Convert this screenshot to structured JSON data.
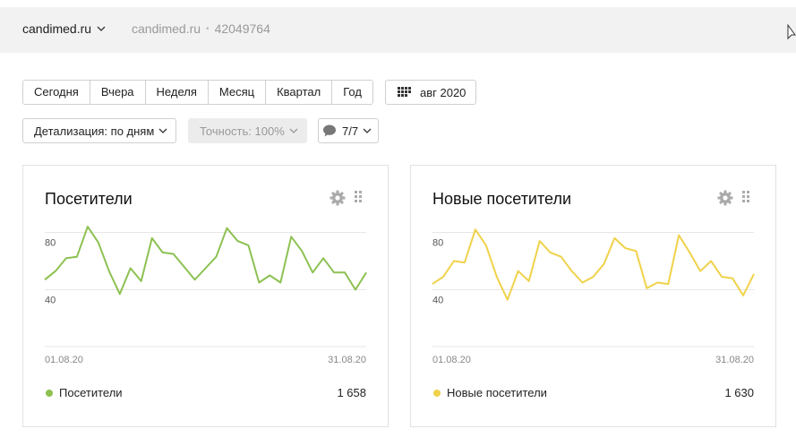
{
  "header": {
    "site_name": "candimed.ru",
    "site_domain": "candimed.ru",
    "site_separator": "•",
    "counter_id": "42049764"
  },
  "period": {
    "buttons": [
      "Сегодня",
      "Вчера",
      "Неделя",
      "Месяц",
      "Квартал",
      "Год"
    ],
    "date_range": "авг 2020"
  },
  "filters": {
    "detail": "Детализация: по дням",
    "accuracy": "Точность: 100%",
    "segments": "7/7"
  },
  "colors": {
    "visitors": "#8cc152",
    "new_visitors": "#f0d24a"
  },
  "widgets": [
    {
      "title": "Посетители",
      "legend": "Посетители",
      "total": "1 658",
      "x_start": "01.08.20",
      "x_end": "31.08.20",
      "y_ticks": [
        "80",
        "40"
      ]
    },
    {
      "title": "Новые посетители",
      "legend": "Новые посетители",
      "total": "1 630",
      "x_start": "01.08.20",
      "x_end": "31.08.20",
      "y_ticks": [
        "80",
        "40"
      ]
    }
  ],
  "chart_data": [
    {
      "type": "line",
      "series": [
        {
          "name": "Посетители",
          "values": [
            47,
            53,
            62,
            63,
            84,
            73,
            53,
            37,
            55,
            46,
            76,
            66,
            65,
            56,
            47,
            55,
            63,
            83,
            74,
            71,
            45,
            50,
            45,
            77,
            67,
            52,
            62,
            52,
            52,
            40,
            52
          ]
        }
      ],
      "x": [
        "01.08.20",
        "02.08.20",
        "03.08.20",
        "04.08.20",
        "05.08.20",
        "06.08.20",
        "07.08.20",
        "08.08.20",
        "09.08.20",
        "10.08.20",
        "11.08.20",
        "12.08.20",
        "13.08.20",
        "14.08.20",
        "15.08.20",
        "16.08.20",
        "17.08.20",
        "18.08.20",
        "19.08.20",
        "20.08.20",
        "21.08.20",
        "22.08.20",
        "23.08.20",
        "24.08.20",
        "25.08.20",
        "26.08.20",
        "27.08.20",
        "28.08.20",
        "29.08.20",
        "30.08.20",
        "31.08.20"
      ],
      "ylim": [
        0,
        100
      ],
      "grid": true,
      "legend_position": "bottom-left"
    },
    {
      "type": "line",
      "series": [
        {
          "name": "Новые посетители",
          "values": [
            44,
            49,
            60,
            59,
            82,
            71,
            49,
            33,
            53,
            46,
            74,
            66,
            63,
            53,
            45,
            49,
            58,
            76,
            69,
            67,
            41,
            45,
            44,
            78,
            66,
            53,
            60,
            49,
            48,
            36,
            51
          ]
        }
      ],
      "x": [
        "01.08.20",
        "02.08.20",
        "03.08.20",
        "04.08.20",
        "05.08.20",
        "06.08.20",
        "07.08.20",
        "08.08.20",
        "09.08.20",
        "10.08.20",
        "11.08.20",
        "12.08.20",
        "13.08.20",
        "14.08.20",
        "15.08.20",
        "16.08.20",
        "17.08.20",
        "18.08.20",
        "19.08.20",
        "20.08.20",
        "21.08.20",
        "22.08.20",
        "23.08.20",
        "24.08.20",
        "25.08.20",
        "26.08.20",
        "27.08.20",
        "28.08.20",
        "29.08.20",
        "30.08.20",
        "31.08.20"
      ],
      "ylim": [
        0,
        100
      ],
      "grid": true,
      "legend_position": "bottom-left"
    }
  ]
}
